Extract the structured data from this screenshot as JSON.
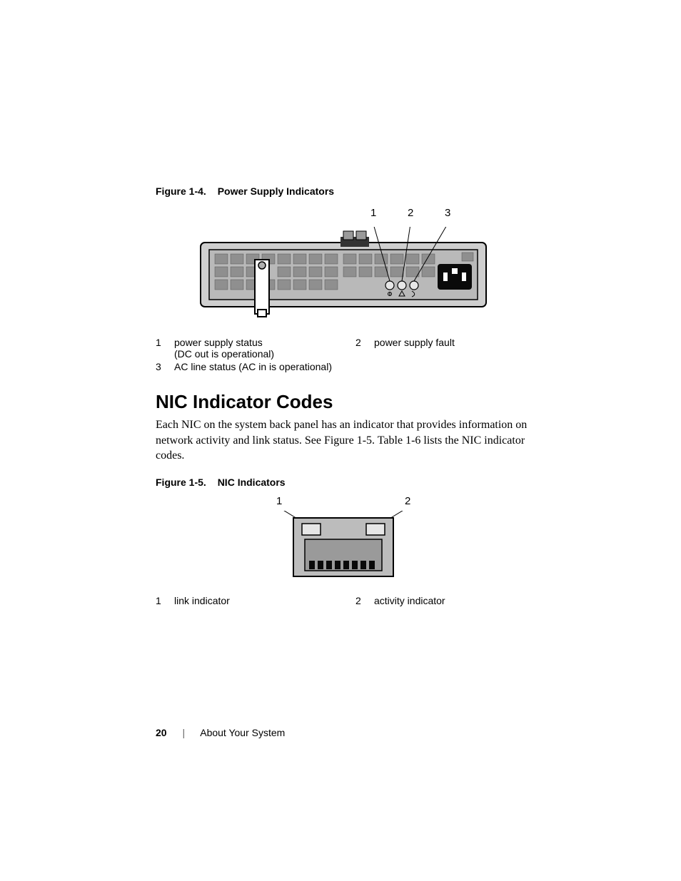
{
  "figure1": {
    "label": "Figure 1-4.",
    "title": "Power Supply Indicators",
    "callouts": {
      "c1": "1",
      "c2": "2",
      "c3": "3"
    },
    "legend": {
      "n1": "1",
      "t1a": "power supply status",
      "t1b": "(DC out is operational)",
      "n2": "2",
      "t2": "power supply fault",
      "n3": "3",
      "t3": "AC line status (AC in is operational)"
    }
  },
  "section": {
    "heading": "NIC Indicator Codes",
    "body": "Each NIC on the system back panel has an indicator that provides information on network activity and link status. See Figure 1-5. Table 1-6 lists the NIC indicator codes."
  },
  "figure2": {
    "label": "Figure 1-5.",
    "title": "NIC Indicators",
    "callouts": {
      "c1": "1",
      "c2": "2"
    },
    "legend": {
      "n1": "1",
      "t1": "link indicator",
      "n2": "2",
      "t2": "activity indicator"
    }
  },
  "footer": {
    "page": "20",
    "section": "About Your System"
  }
}
